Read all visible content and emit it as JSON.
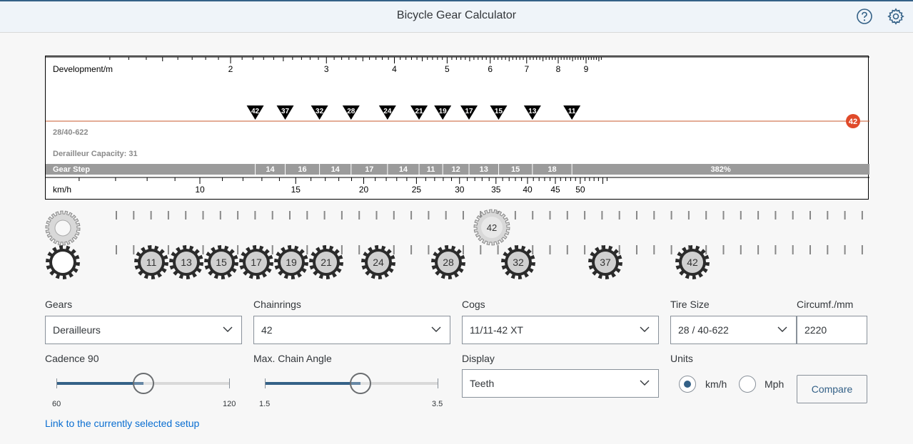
{
  "header": {
    "title": "Bicycle Gear Calculator",
    "help_icon": "help-circle-icon",
    "settings_icon": "gear-icon"
  },
  "diagram": {
    "development": {
      "label": "Development/m",
      "ticks": [
        "2",
        "3",
        "4",
        "5",
        "6",
        "7",
        "8",
        "9"
      ]
    },
    "cog_markers": [
      "42",
      "37",
      "32",
      "28",
      "24",
      "21",
      "19",
      "17",
      "15",
      "13",
      "11"
    ],
    "chainring_badge": "42",
    "setup_label": "28/40-622",
    "derailleur_capacity": "Derailleur Capacity: 31",
    "gear_step": {
      "label": "Gear Step",
      "values": [
        "14",
        "16",
        "14",
        "17",
        "14",
        "11",
        "12",
        "13",
        "15",
        "18",
        "382%"
      ]
    },
    "speed": {
      "label": "km/h",
      "ticks": [
        "10",
        "15",
        "20",
        "25",
        "30",
        "35",
        "40",
        "45",
        "50"
      ]
    },
    "accent_color": "#e04a2a",
    "bar_color": "#9b9b9b"
  },
  "cogs": {
    "chainring_top": "42",
    "cog_labels": [
      "11",
      "13",
      "15",
      "17",
      "19",
      "21",
      "24",
      "28",
      "32",
      "37",
      "42"
    ]
  },
  "form": {
    "gears": {
      "label": "Gears",
      "value": "Derailleurs"
    },
    "chainrings": {
      "label": "Chainrings",
      "value": "42"
    },
    "cogs": {
      "label": "Cogs",
      "value": "11/11-42 XT"
    },
    "tire_size": {
      "label": "Tire Size",
      "value": "28 / 40-622"
    },
    "circumference": {
      "label": "Circumf./mm",
      "value": "2220"
    },
    "cadence": {
      "label": "Cadence 90",
      "min": "60",
      "max": "120",
      "level": 0.5
    },
    "chain_angle": {
      "label": "Max. Chain Angle",
      "min": "1.5",
      "max": "3.5",
      "level": 0.55
    },
    "display": {
      "label": "Display",
      "value": "Teeth"
    },
    "units": {
      "label": "Units",
      "option_kmh": "km/h",
      "option_mph": "Mph",
      "selected": "km/h"
    },
    "compare_label": "Compare",
    "link_text": "Link to the currently selected setup"
  }
}
